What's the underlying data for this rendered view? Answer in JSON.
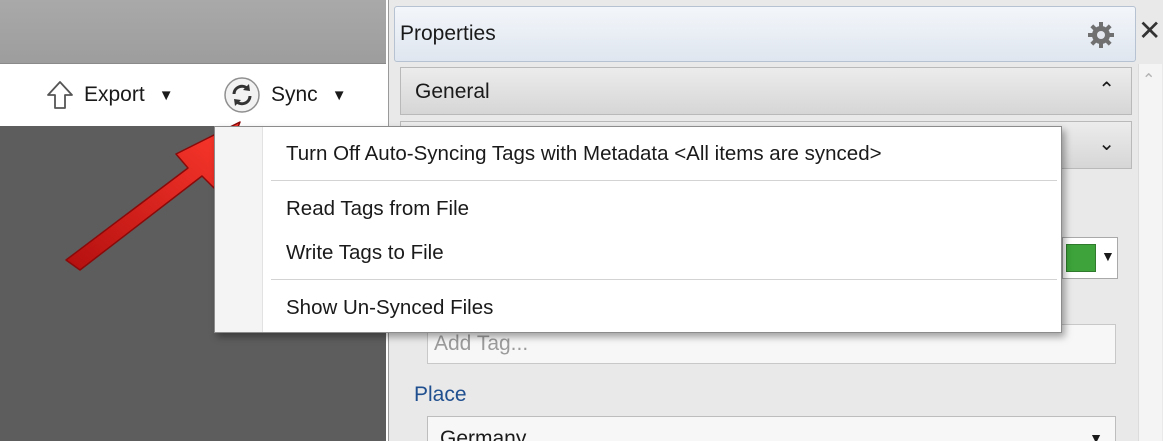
{
  "toolbar": {
    "export_label": "Export",
    "sync_label": "Sync",
    "export_icon": "export-arrow-up-icon",
    "sync_icon": "sync-circular-arrows-icon"
  },
  "sync_menu": {
    "items": [
      "Turn Off Auto-Syncing Tags with Metadata <All items are synced>",
      "Read Tags from File",
      "Write Tags to File",
      "Show Un-Synced Files"
    ]
  },
  "properties": {
    "title": "Properties",
    "sections": [
      "General"
    ],
    "tag_placeholder": "Add Tag...",
    "place_label": "Place",
    "place_value": "Germany",
    "color_swatch": "#3da33a"
  },
  "colors": {
    "header_top": "#f3f6fa",
    "header_bottom": "#dfe6ef",
    "dark_pane": "#5d5d5d",
    "arrow_red": "#e01b1b",
    "place_label": "#1f4f8f"
  }
}
